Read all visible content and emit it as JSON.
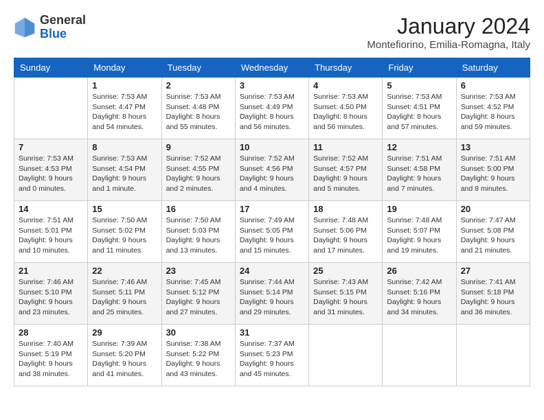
{
  "header": {
    "logo_general": "General",
    "logo_blue": "Blue",
    "month_year": "January 2024",
    "location": "Montefiorino, Emilia-Romagna, Italy"
  },
  "days_of_week": [
    "Sunday",
    "Monday",
    "Tuesday",
    "Wednesday",
    "Thursday",
    "Friday",
    "Saturday"
  ],
  "weeks": [
    [
      {
        "day": "",
        "sunrise": "",
        "sunset": "",
        "daylight": ""
      },
      {
        "day": "1",
        "sunrise": "Sunrise: 7:53 AM",
        "sunset": "Sunset: 4:47 PM",
        "daylight": "Daylight: 8 hours and 54 minutes."
      },
      {
        "day": "2",
        "sunrise": "Sunrise: 7:53 AM",
        "sunset": "Sunset: 4:48 PM",
        "daylight": "Daylight: 8 hours and 55 minutes."
      },
      {
        "day": "3",
        "sunrise": "Sunrise: 7:53 AM",
        "sunset": "Sunset: 4:49 PM",
        "daylight": "Daylight: 8 hours and 56 minutes."
      },
      {
        "day": "4",
        "sunrise": "Sunrise: 7:53 AM",
        "sunset": "Sunset: 4:50 PM",
        "daylight": "Daylight: 8 hours and 56 minutes."
      },
      {
        "day": "5",
        "sunrise": "Sunrise: 7:53 AM",
        "sunset": "Sunset: 4:51 PM",
        "daylight": "Daylight: 8 hours and 57 minutes."
      },
      {
        "day": "6",
        "sunrise": "Sunrise: 7:53 AM",
        "sunset": "Sunset: 4:52 PM",
        "daylight": "Daylight: 8 hours and 59 minutes."
      }
    ],
    [
      {
        "day": "7",
        "sunrise": "Sunrise: 7:53 AM",
        "sunset": "Sunset: 4:53 PM",
        "daylight": "Daylight: 9 hours and 0 minutes."
      },
      {
        "day": "8",
        "sunrise": "Sunrise: 7:53 AM",
        "sunset": "Sunset: 4:54 PM",
        "daylight": "Daylight: 9 hours and 1 minute."
      },
      {
        "day": "9",
        "sunrise": "Sunrise: 7:52 AM",
        "sunset": "Sunset: 4:55 PM",
        "daylight": "Daylight: 9 hours and 2 minutes."
      },
      {
        "day": "10",
        "sunrise": "Sunrise: 7:52 AM",
        "sunset": "Sunset: 4:56 PM",
        "daylight": "Daylight: 9 hours and 4 minutes."
      },
      {
        "day": "11",
        "sunrise": "Sunrise: 7:52 AM",
        "sunset": "Sunset: 4:57 PM",
        "daylight": "Daylight: 9 hours and 5 minutes."
      },
      {
        "day": "12",
        "sunrise": "Sunrise: 7:51 AM",
        "sunset": "Sunset: 4:58 PM",
        "daylight": "Daylight: 9 hours and 7 minutes."
      },
      {
        "day": "13",
        "sunrise": "Sunrise: 7:51 AM",
        "sunset": "Sunset: 5:00 PM",
        "daylight": "Daylight: 9 hours and 8 minutes."
      }
    ],
    [
      {
        "day": "14",
        "sunrise": "Sunrise: 7:51 AM",
        "sunset": "Sunset: 5:01 PM",
        "daylight": "Daylight: 9 hours and 10 minutes."
      },
      {
        "day": "15",
        "sunrise": "Sunrise: 7:50 AM",
        "sunset": "Sunset: 5:02 PM",
        "daylight": "Daylight: 9 hours and 11 minutes."
      },
      {
        "day": "16",
        "sunrise": "Sunrise: 7:50 AM",
        "sunset": "Sunset: 5:03 PM",
        "daylight": "Daylight: 9 hours and 13 minutes."
      },
      {
        "day": "17",
        "sunrise": "Sunrise: 7:49 AM",
        "sunset": "Sunset: 5:05 PM",
        "daylight": "Daylight: 9 hours and 15 minutes."
      },
      {
        "day": "18",
        "sunrise": "Sunrise: 7:48 AM",
        "sunset": "Sunset: 5:06 PM",
        "daylight": "Daylight: 9 hours and 17 minutes."
      },
      {
        "day": "19",
        "sunrise": "Sunrise: 7:48 AM",
        "sunset": "Sunset: 5:07 PM",
        "daylight": "Daylight: 9 hours and 19 minutes."
      },
      {
        "day": "20",
        "sunrise": "Sunrise: 7:47 AM",
        "sunset": "Sunset: 5:08 PM",
        "daylight": "Daylight: 9 hours and 21 minutes."
      }
    ],
    [
      {
        "day": "21",
        "sunrise": "Sunrise: 7:46 AM",
        "sunset": "Sunset: 5:10 PM",
        "daylight": "Daylight: 9 hours and 23 minutes."
      },
      {
        "day": "22",
        "sunrise": "Sunrise: 7:46 AM",
        "sunset": "Sunset: 5:11 PM",
        "daylight": "Daylight: 9 hours and 25 minutes."
      },
      {
        "day": "23",
        "sunrise": "Sunrise: 7:45 AM",
        "sunset": "Sunset: 5:12 PM",
        "daylight": "Daylight: 9 hours and 27 minutes."
      },
      {
        "day": "24",
        "sunrise": "Sunrise: 7:44 AM",
        "sunset": "Sunset: 5:14 PM",
        "daylight": "Daylight: 9 hours and 29 minutes."
      },
      {
        "day": "25",
        "sunrise": "Sunrise: 7:43 AM",
        "sunset": "Sunset: 5:15 PM",
        "daylight": "Daylight: 9 hours and 31 minutes."
      },
      {
        "day": "26",
        "sunrise": "Sunrise: 7:42 AM",
        "sunset": "Sunset: 5:16 PM",
        "daylight": "Daylight: 9 hours and 34 minutes."
      },
      {
        "day": "27",
        "sunrise": "Sunrise: 7:41 AM",
        "sunset": "Sunset: 5:18 PM",
        "daylight": "Daylight: 9 hours and 36 minutes."
      }
    ],
    [
      {
        "day": "28",
        "sunrise": "Sunrise: 7:40 AM",
        "sunset": "Sunset: 5:19 PM",
        "daylight": "Daylight: 9 hours and 38 minutes."
      },
      {
        "day": "29",
        "sunrise": "Sunrise: 7:39 AM",
        "sunset": "Sunset: 5:20 PM",
        "daylight": "Daylight: 9 hours and 41 minutes."
      },
      {
        "day": "30",
        "sunrise": "Sunrise: 7:38 AM",
        "sunset": "Sunset: 5:22 PM",
        "daylight": "Daylight: 9 hours and 43 minutes."
      },
      {
        "day": "31",
        "sunrise": "Sunrise: 7:37 AM",
        "sunset": "Sunset: 5:23 PM",
        "daylight": "Daylight: 9 hours and 45 minutes."
      },
      {
        "day": "",
        "sunrise": "",
        "sunset": "",
        "daylight": ""
      },
      {
        "day": "",
        "sunrise": "",
        "sunset": "",
        "daylight": ""
      },
      {
        "day": "",
        "sunrise": "",
        "sunset": "",
        "daylight": ""
      }
    ]
  ]
}
